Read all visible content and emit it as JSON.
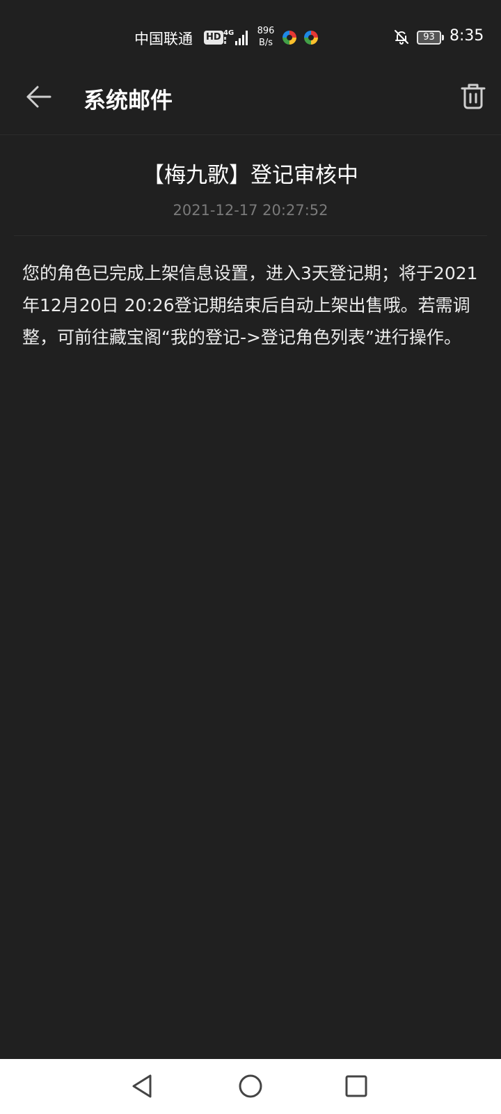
{
  "status_bar": {
    "carrier": "中国联通",
    "hd_badge": "HD",
    "network_type": "4G",
    "net_speed_value": "896",
    "net_speed_unit": "B/s",
    "battery_level": "93",
    "time": "8:35",
    "icons": [
      "signal-icon",
      "app-icon",
      "app-icon",
      "bell-off-icon",
      "battery-icon"
    ]
  },
  "app_bar": {
    "title": "系统邮件",
    "back_icon": "arrow-left-icon",
    "delete_icon": "trash-icon"
  },
  "message": {
    "title": "【梅九歌】登记审核中",
    "timestamp": "2021-12-17 20:27:52",
    "body": "您的角色已完成上架信息设置，进入3天登记期；将于2021年12月20日 20:26登记期结束后自动上架出售哦。若需调整，可前往藏宝阁“我的登记->登记角色列表”进行操作。"
  },
  "nav_bar": {
    "icons": [
      "nav-back-icon",
      "nav-home-icon",
      "nav-recents-icon"
    ]
  },
  "colors": {
    "background": "#202020",
    "text_primary": "#ffffff",
    "text_secondary": "#7a7a7a",
    "nav_background": "#ffffff"
  }
}
